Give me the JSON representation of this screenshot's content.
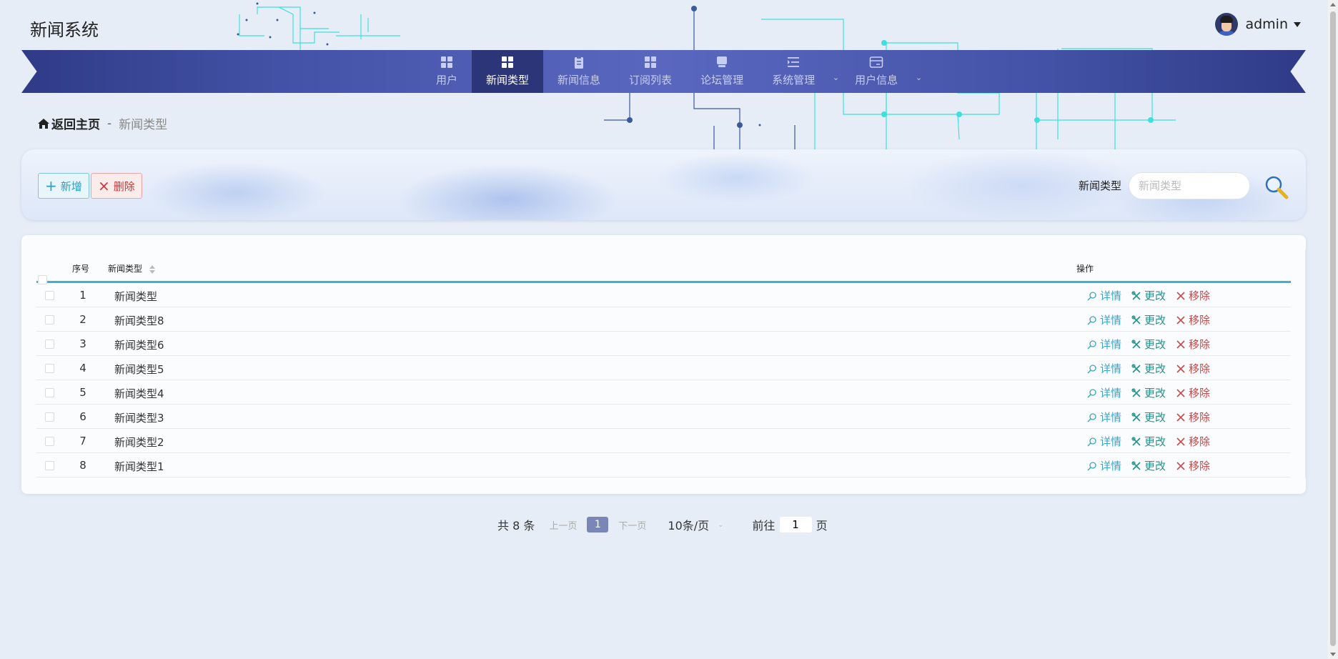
{
  "app": {
    "title": "新闻系统"
  },
  "user": {
    "name": "admin"
  },
  "nav": {
    "items": [
      {
        "label": "用户",
        "icon": "grid-icon",
        "active": false
      },
      {
        "label": "新闻类型",
        "icon": "grid-icon",
        "active": true
      },
      {
        "label": "新闻信息",
        "icon": "clipboard-icon",
        "active": false
      },
      {
        "label": "订阅列表",
        "icon": "grid-icon",
        "active": false
      },
      {
        "label": "论坛管理",
        "icon": "box-icon",
        "active": false
      },
      {
        "label": "系统管理",
        "icon": "list-indent-icon",
        "active": false,
        "dropdown": true
      },
      {
        "label": "用户信息",
        "icon": "card-icon",
        "active": false,
        "dropdown": true
      }
    ]
  },
  "breadcrumb": {
    "home": "返回主页",
    "separator": "-",
    "current": "新闻类型"
  },
  "toolbar": {
    "add_label": "新增",
    "delete_label": "删除"
  },
  "search": {
    "label": "新闻类型",
    "placeholder": "新闻类型"
  },
  "table": {
    "columns": {
      "index": "序号",
      "type": "新闻类型",
      "ops": "操作"
    },
    "rows": [
      {
        "idx": "1",
        "name": "新闻类型"
      },
      {
        "idx": "2",
        "name": "新闻类型8"
      },
      {
        "idx": "3",
        "name": "新闻类型6"
      },
      {
        "idx": "4",
        "name": "新闻类型5"
      },
      {
        "idx": "5",
        "name": "新闻类型4"
      },
      {
        "idx": "6",
        "name": "新闻类型3"
      },
      {
        "idx": "7",
        "name": "新闻类型2"
      },
      {
        "idx": "8",
        "name": "新闻类型1"
      }
    ],
    "actions": {
      "detail": "详情",
      "edit": "更改",
      "remove": "移除"
    }
  },
  "pagination": {
    "total": "共 8 条",
    "prev": "上一页",
    "current_page": "1",
    "next": "下一页",
    "page_size": "10条/页",
    "goto_prefix": "前往",
    "goto_value": "1",
    "goto_suffix": "页"
  },
  "colors": {
    "nav_active": "#2b3577",
    "accent": "#36b4d1",
    "add": "#2a9fc1",
    "delete": "#d23333",
    "edit": "#22928b",
    "remove": "#c94848",
    "page_current": "#7a86b8"
  }
}
